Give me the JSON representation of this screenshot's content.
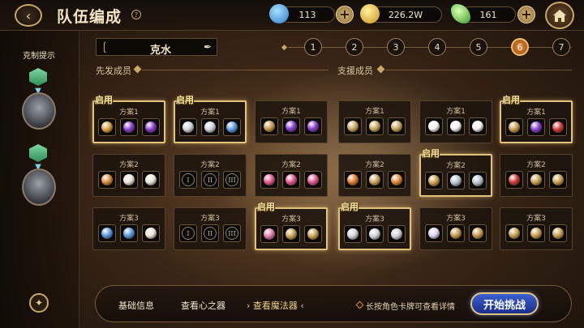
{
  "header": {
    "title": "队伍编成",
    "help_glyph": "?",
    "resources": [
      {
        "name": "water-drop",
        "value": "113",
        "color": "#3aa8e8"
      },
      {
        "name": "gold-coin",
        "value": "226.2W",
        "color": "#e8b830"
      },
      {
        "name": "green-crystal",
        "value": "161",
        "color": "#6ad04a"
      }
    ]
  },
  "left_panel": {
    "hint_label": "克制提示"
  },
  "element": {
    "label": "克水"
  },
  "sections": {
    "starters": "先发成员",
    "supports": "支援成员"
  },
  "team_tabs": {
    "labels": [
      "1",
      "2",
      "3",
      "4",
      "5",
      "6",
      "7"
    ],
    "active": "6"
  },
  "enabled_label": "启用",
  "plans": [
    [
      {
        "label": "方案1",
        "active": true,
        "items": [
          "orb-gold",
          "orb-purple",
          "orb-purple"
        ]
      },
      {
        "label": "方案1",
        "active": true,
        "items": [
          "shield-silver",
          "shield-silver",
          "spear-blue"
        ]
      },
      {
        "label": "方案1",
        "active": false,
        "items": [
          "pouch-gold",
          "orb-purple",
          "orb-purple"
        ]
      },
      {
        "label": "方案1",
        "active": false,
        "items": [
          "sword-gold",
          "sword-gold",
          "sword-gold"
        ]
      },
      {
        "label": "方案1",
        "active": false,
        "items": [
          "glove-white",
          "glove-white",
          "glove-white"
        ]
      },
      {
        "label": "方案1",
        "active": true,
        "items": [
          "pouch-gold",
          "orb-purple",
          "orb-red"
        ]
      }
    ],
    [
      {
        "label": "方案2",
        "active": false,
        "items": [
          "spear-orange",
          "pouch-white",
          "pouch-white"
        ]
      },
      {
        "label": "方案2",
        "active": false,
        "items": [
          "I",
          "II",
          "III"
        ]
      },
      {
        "label": "方案2",
        "active": false,
        "items": [
          "potion-pink",
          "potion-pink",
          "potion-pink"
        ]
      },
      {
        "label": "方案2",
        "active": false,
        "items": [
          "sword-orange",
          "sword-gold",
          "spear-orange"
        ]
      },
      {
        "label": "方案2",
        "active": true,
        "items": [
          "shield-gold",
          "trident-silver",
          "trident-silver"
        ]
      },
      {
        "label": "方案2",
        "active": false,
        "items": [
          "orb-red",
          "shield-gold",
          "shield-gold"
        ]
      }
    ],
    [
      {
        "label": "方案3",
        "active": false,
        "items": [
          "spear-blue",
          "spear-blue",
          "pouch-white"
        ]
      },
      {
        "label": "方案3",
        "active": false,
        "items": [
          "I",
          "II",
          "III"
        ]
      },
      {
        "label": "方案3",
        "active": true,
        "items": [
          "orb-pink",
          "shield-gold",
          "shield-gold"
        ]
      },
      {
        "label": "方案3",
        "active": true,
        "items": [
          "shield-silver",
          "shield-silver",
          "shield-silver"
        ]
      },
      {
        "label": "方案3",
        "active": false,
        "items": [
          "potion-white",
          "pouch-gold",
          "pouch-gold"
        ]
      },
      {
        "label": "方案3",
        "active": false,
        "items": [
          "shield-gold",
          "shield-gold",
          "shield-gold"
        ]
      }
    ]
  ],
  "item_colors": {
    "orb-gold": "#d9a040",
    "orb-purple": "#8a40d0",
    "orb-red": "#d03a3a",
    "orb-pink": "#e07aa8",
    "shield-silver": "#cfd3d8",
    "shield-gold": "#c8a050",
    "spear-blue": "#5a9ae0",
    "spear-orange": "#e08a3a",
    "pouch-gold": "#c89a50",
    "pouch-white": "#ece4d6",
    "sword-gold": "#c8a860",
    "sword-orange": "#e07a30",
    "glove-white": "#f2f2f2",
    "potion-pink": "#e05a90",
    "potion-white": "#dcd6f0",
    "trident-silver": "#b8c4d0"
  },
  "bottom": {
    "basic_info": "基础信息",
    "view_heart": "查看心之器",
    "view_magic": "查看魔法器",
    "hint": "长按角色卡牌可查看详情",
    "start": "开始挑战"
  }
}
